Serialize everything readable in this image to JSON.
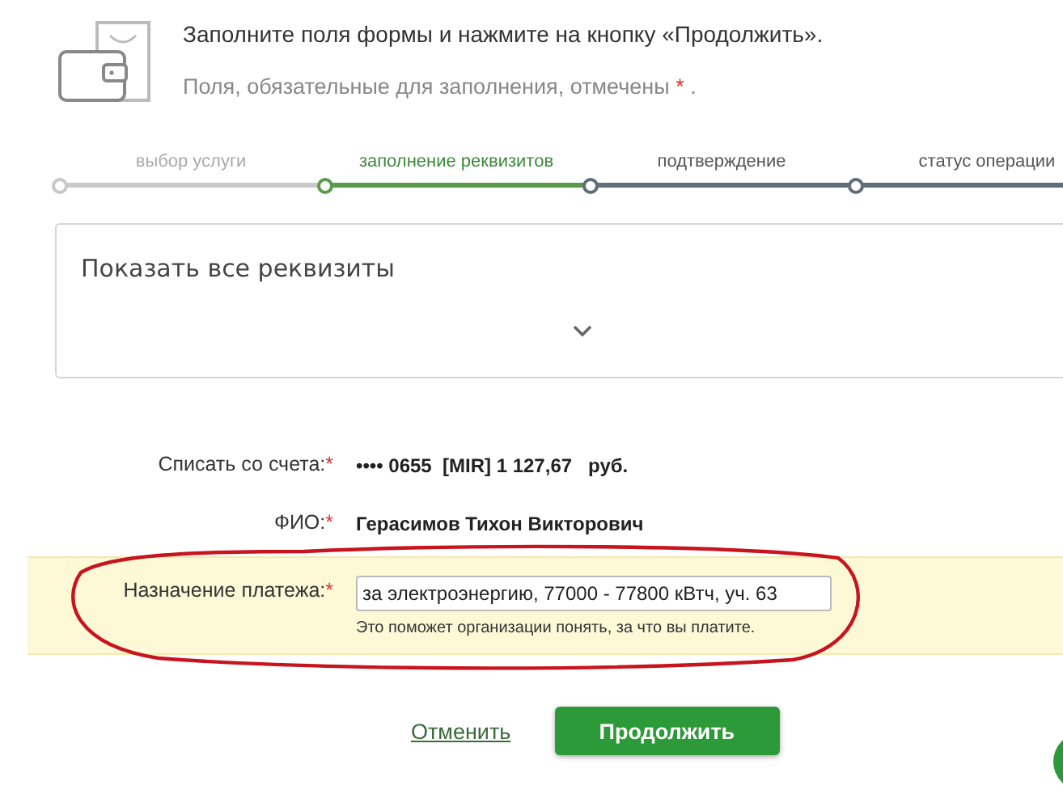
{
  "header": {
    "title": "Заполните поля формы и нажмите на кнопку «Продолжить».",
    "note": "Поля, обязательные для заполнения, отмечены",
    "note_mark": "*",
    "note_end": "."
  },
  "steps": [
    {
      "label": "выбор услуги",
      "done": true,
      "selected": false
    },
    {
      "label": "заполнение реквизитов",
      "done": false,
      "selected": true
    },
    {
      "label": "подтверждение",
      "done": false,
      "selected": false
    },
    {
      "label": "статус операции",
      "done": false,
      "selected": false
    }
  ],
  "details_panel": {
    "title": "Показать все реквизиты",
    "expanded": false
  },
  "fields": [
    {
      "kind": "text",
      "label": "Списать со счета:",
      "required": true,
      "value": "•••• 0655  [MIR] 1 127,67   руб.",
      "highlighted": false
    },
    {
      "kind": "text",
      "label": "ФИО:",
      "required": true,
      "value": "Герасимов Тихон Викторович",
      "highlighted": false
    },
    {
      "kind": "input",
      "label": "Назначение платежа:",
      "required": true,
      "value": "за электроэнергию, 77000 - 77800 кВтч, уч. 63",
      "hint": "Это поможет организации понять, за что вы платите.",
      "highlighted": true
    }
  ],
  "actions": {
    "cancel": "Отменить",
    "submit": "Продолжить"
  }
}
